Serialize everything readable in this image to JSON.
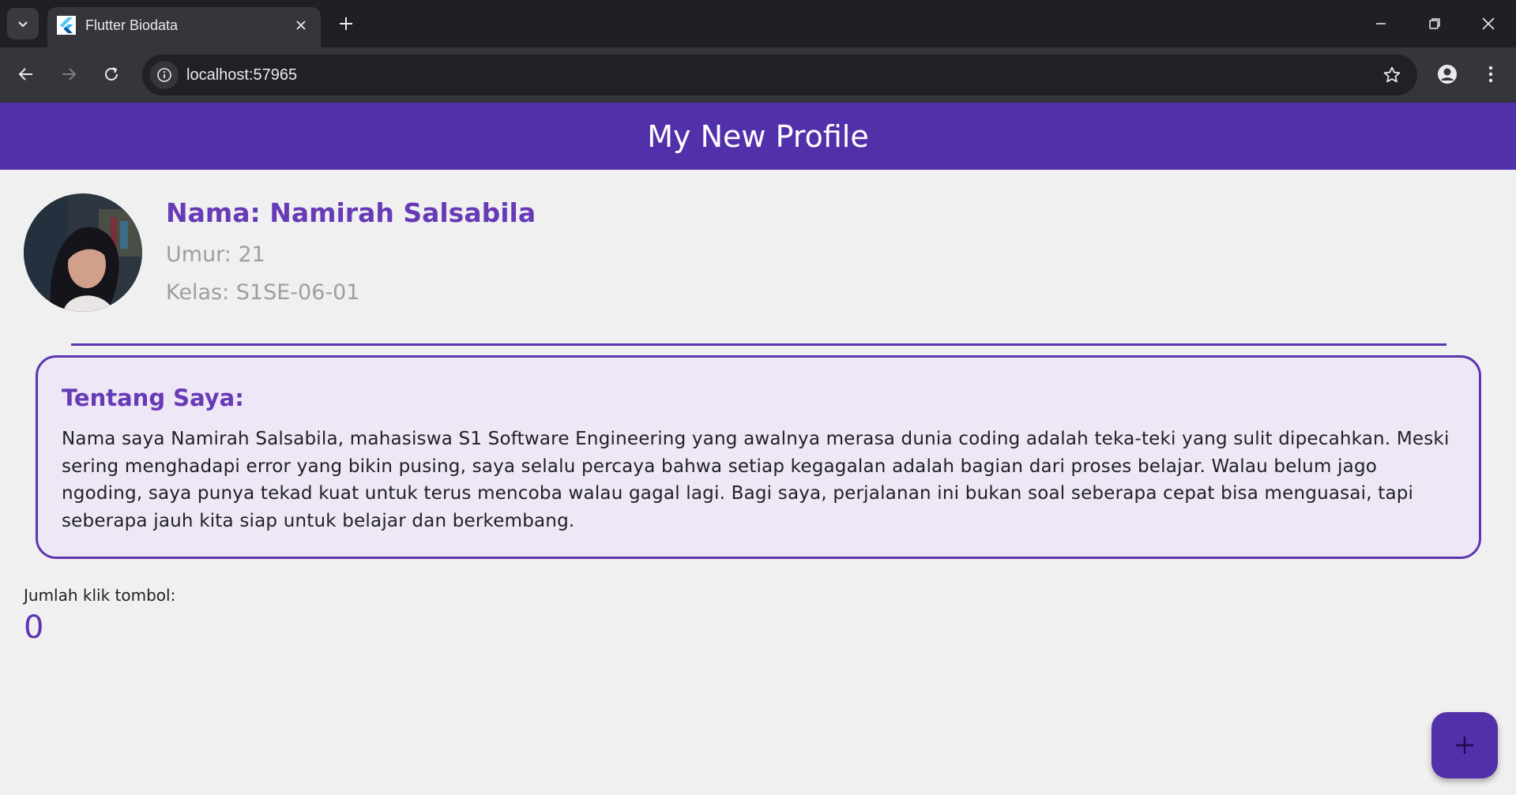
{
  "browser": {
    "tab_title": "Flutter Biodata",
    "url": "localhost:57965"
  },
  "app": {
    "title": "My New Profile",
    "accent": "#5230aa",
    "primary_text": "#673ab7"
  },
  "profile": {
    "name": "Nama: Namirah Salsabila",
    "age": "Umur: 21",
    "class": "Kelas: S1SE-06-01"
  },
  "about": {
    "title": "Tentang Saya:",
    "body": "Nama saya Namirah Salsabila, mahasiswa S1 Software Engineering yang awalnya merasa dunia coding adalah teka-teki yang sulit dipecahkan. Meski sering menghadapi error yang bikin pusing, saya selalu percaya bahwa setiap kegagalan adalah bagian dari proses belajar. Walau belum jago ngoding, saya punya tekad kuat untuk terus mencoba walau gagal lagi. Bagi saya, perjalanan ini bukan soal seberapa cepat bisa menguasai, tapi seberapa jauh kita siap untuk belajar dan berkembang."
  },
  "counter": {
    "label": "Jumlah klik tombol:",
    "value": "0"
  },
  "icons": {
    "fab": "plus-icon"
  }
}
